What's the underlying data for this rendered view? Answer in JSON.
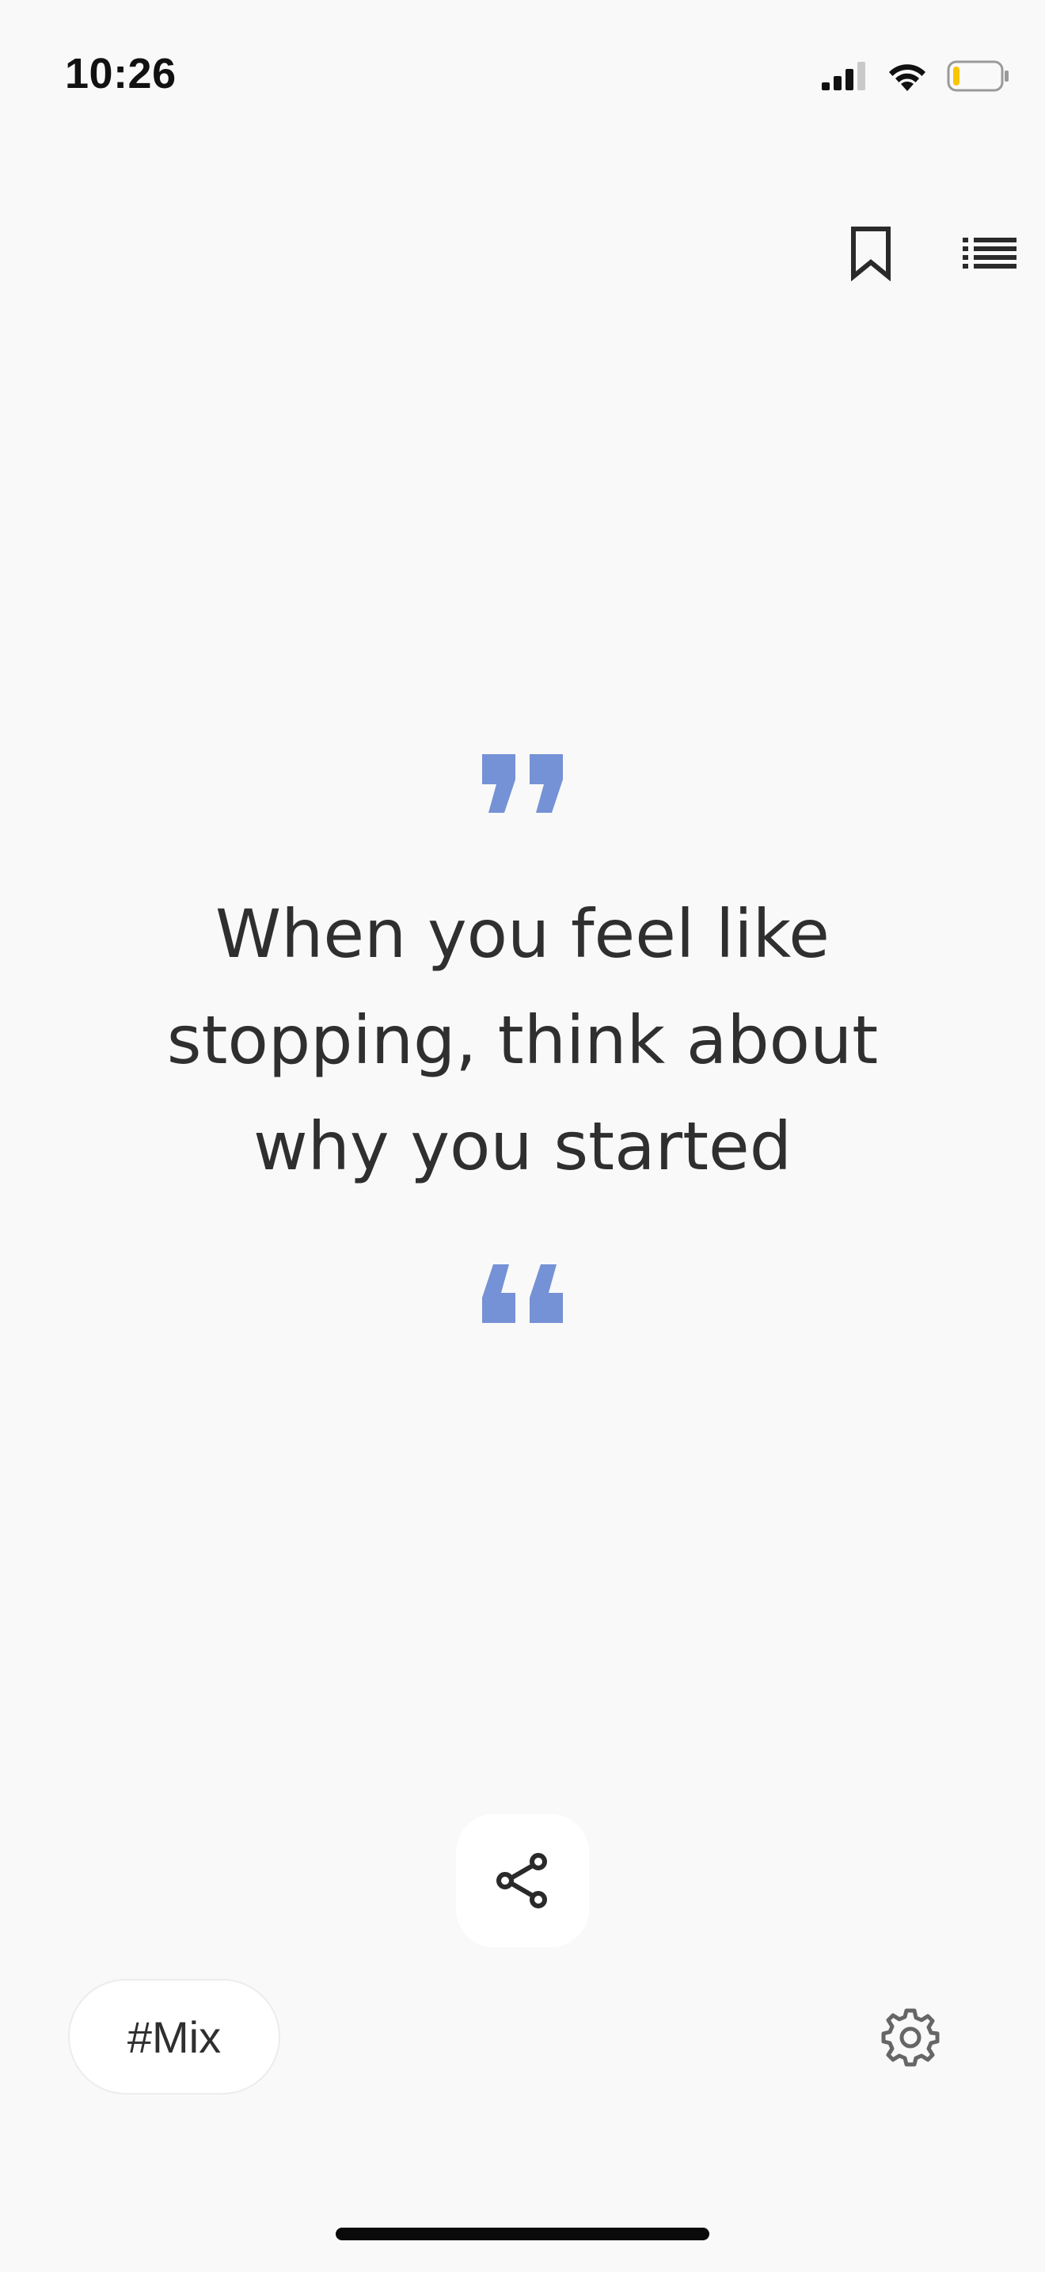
{
  "status_bar": {
    "time": "10:26"
  },
  "quote": {
    "text": "When you feel like stopping, think about why you started"
  },
  "footer": {
    "category_label": "#Mix"
  },
  "colors": {
    "accent": "#7592d6",
    "text": "#2f2f2f",
    "background": "#f9f9f9",
    "battery_low": "#f7c600"
  },
  "icons": {
    "bookmark": "bookmark-icon",
    "list": "list-icon",
    "share": "share-icon",
    "settings": "gear-icon",
    "open_quote": "open-quote-icon",
    "close_quote": "close-quote-icon"
  },
  "battery_level": 0.15
}
